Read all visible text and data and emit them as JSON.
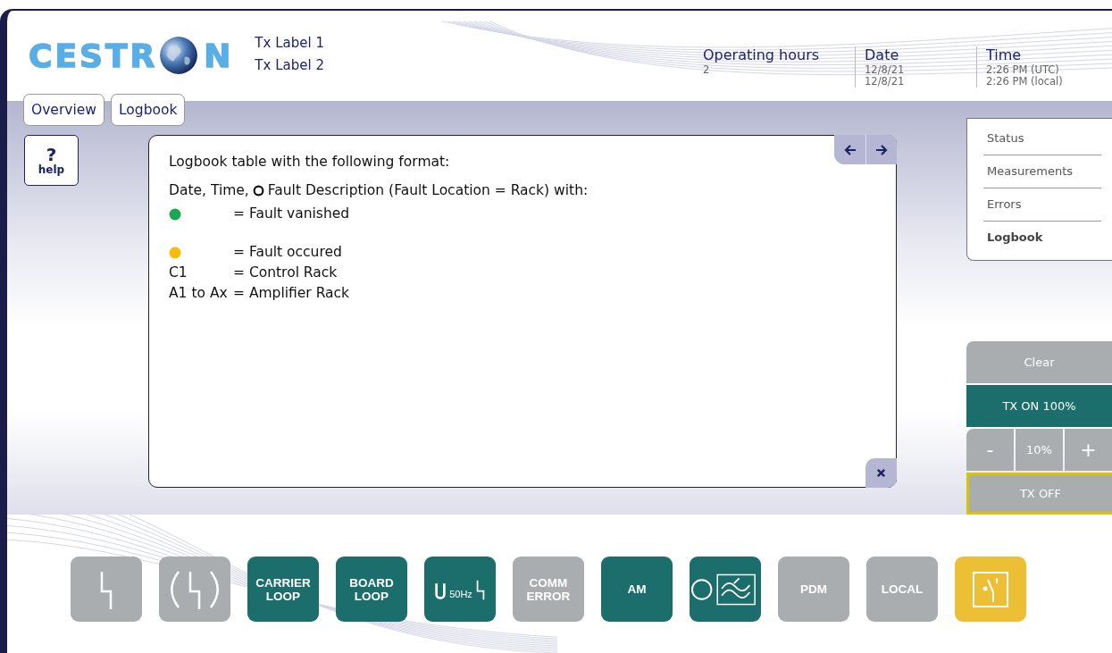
{
  "logo": {
    "left": "CESTR",
    "right": "N"
  },
  "tx_labels": [
    "Tx Label 1",
    "Tx Label 2"
  ],
  "info": [
    {
      "title": "Operating hours",
      "values": [
        "2"
      ]
    },
    {
      "title": "Date",
      "values": [
        "12/8/21",
        "12/8/21"
      ]
    },
    {
      "title": "Time",
      "values": [
        "2:26 PM (UTC)",
        "2:26 PM (local)"
      ]
    }
  ],
  "tabs": [
    {
      "label": "Overview"
    },
    {
      "label": "Logbook"
    }
  ],
  "help": {
    "symbol": "?",
    "label": "help"
  },
  "panel": {
    "heading": "Logbook table with the following format:",
    "format_before": "Date, Time,",
    "format_after": "Fault Description (Fault Location = Rack) with:",
    "legend": [
      {
        "kind": "dot",
        "color": "#1aa84f",
        "text": "= Fault vanished"
      },
      {
        "kind": "dot",
        "color": "#f7bb0a",
        "text": "= Fault occured"
      },
      {
        "kind": "code",
        "code": "C1",
        "text": "= Control Rack"
      },
      {
        "kind": "code",
        "code": "A1 to Ax",
        "text": "= Amplifier Rack"
      }
    ]
  },
  "menu": [
    {
      "label": "Status",
      "selected": false
    },
    {
      "label": "Measurements",
      "selected": false
    },
    {
      "label": "Errors",
      "selected": false
    },
    {
      "label": "Logbook",
      "selected": true
    }
  ],
  "controls": {
    "clear": "Clear",
    "tx_on": {
      "label": "TX ON 100%",
      "active": true
    },
    "minus": "-",
    "step": "10%",
    "plus": "+",
    "tx_off": {
      "label": "TX OFF",
      "highlighted": true
    }
  },
  "status_buttons": [
    {
      "kind": "lightning",
      "on": false,
      "alert": false
    },
    {
      "kind": "lightning-brackets",
      "on": false,
      "alert": false
    },
    {
      "kind": "text",
      "on": true,
      "alert": false,
      "lines": [
        "CARRIER",
        "LOOP"
      ]
    },
    {
      "kind": "text",
      "on": true,
      "alert": false,
      "lines": [
        "BOARD",
        "LOOP"
      ]
    },
    {
      "kind": "voltage",
      "on": true,
      "alert": false,
      "lines": [
        "50Hz"
      ]
    },
    {
      "kind": "text",
      "on": false,
      "alert": false,
      "lines": [
        "COMM",
        "ERROR"
      ]
    },
    {
      "kind": "text",
      "on": true,
      "alert": false,
      "lines": [
        "AM"
      ]
    },
    {
      "kind": "oscillator",
      "on": true,
      "alert": false
    },
    {
      "kind": "text",
      "on": false,
      "alert": false,
      "lines": [
        "PDM"
      ]
    },
    {
      "kind": "text",
      "on": false,
      "alert": false,
      "lines": [
        "LOCAL"
      ]
    },
    {
      "kind": "switch",
      "on": false,
      "alert": true
    }
  ]
}
